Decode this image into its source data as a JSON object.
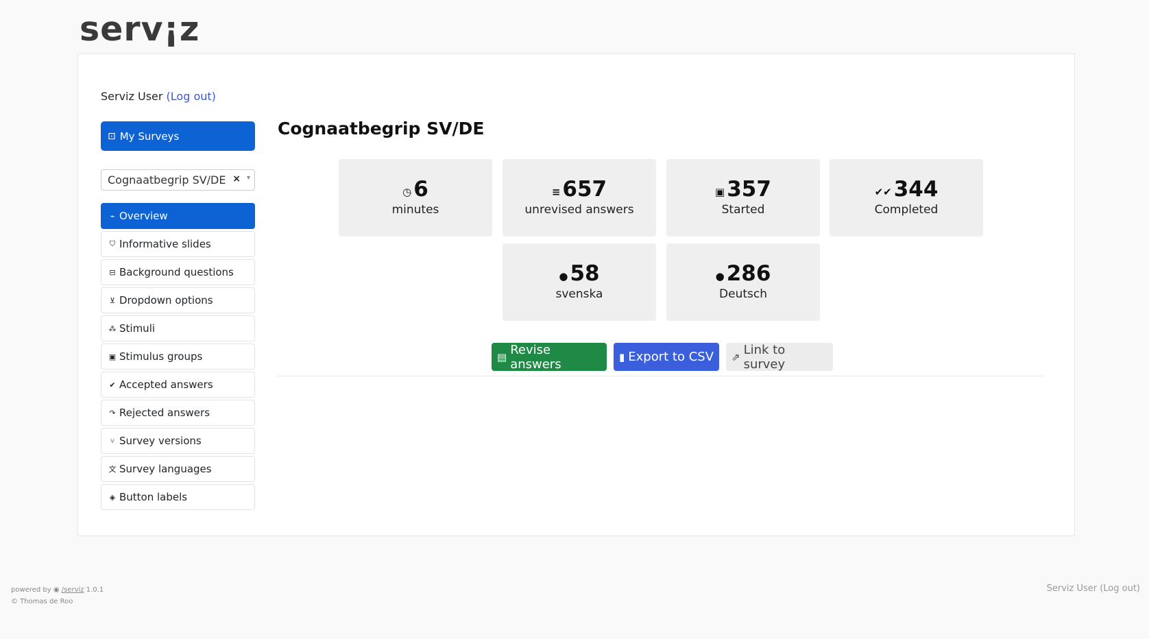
{
  "logo": "serv¡z",
  "user": {
    "name": "Serviz User",
    "logout": "(Log out)"
  },
  "sidebar": {
    "my_surveys": {
      "icon": "⊡",
      "label": "My Surveys"
    },
    "survey_select": {
      "value": "Cognaatbegrip SV/DE",
      "clear": "×",
      "caret": "▾"
    },
    "items": [
      {
        "icon": "⌁",
        "label": "Overview"
      },
      {
        "icon": "⛉",
        "label": "Informative slides"
      },
      {
        "icon": "⊟",
        "label": "Background questions"
      },
      {
        "icon": "⊻",
        "label": "Dropdown options"
      },
      {
        "icon": "⁂",
        "label": "Stimuli"
      },
      {
        "icon": "▣",
        "label": "Stimulus groups"
      },
      {
        "icon": "✔",
        "label": "Accepted answers"
      },
      {
        "icon": "↷",
        "label": "Rejected answers"
      },
      {
        "icon": "⑂",
        "label": "Survey versions"
      },
      {
        "icon": "文",
        "label": "Survey languages"
      },
      {
        "icon": "◈",
        "label": "Button labels"
      }
    ]
  },
  "main": {
    "title": "Cognaatbegrip SV/DE",
    "stats": [
      {
        "icon": "◷",
        "value": "6",
        "label": "minutes"
      },
      {
        "icon": "≡",
        "value": "657",
        "label": "unrevised answers"
      },
      {
        "icon": "▣",
        "value": "357",
        "label": "Started"
      },
      {
        "icon": "✔✔",
        "value": "344",
        "label": "Completed"
      },
      {
        "icon": "●",
        "value": "58",
        "label": "svenska"
      },
      {
        "icon": "●",
        "value": "286",
        "label": "Deutsch"
      }
    ],
    "buttons": {
      "revise": {
        "icon": "▤",
        "label": "Revise answers"
      },
      "export": {
        "icon": "▮",
        "label": "Export to CSV"
      },
      "link": {
        "icon": "⇗",
        "label": "Link to survey"
      }
    }
  },
  "footer": {
    "powered": "powered by",
    "repo": "/serviz",
    "version": "1.0.1",
    "copyright": "© Thomas de Roo",
    "user_text": "Serviz User (Log out)"
  }
}
